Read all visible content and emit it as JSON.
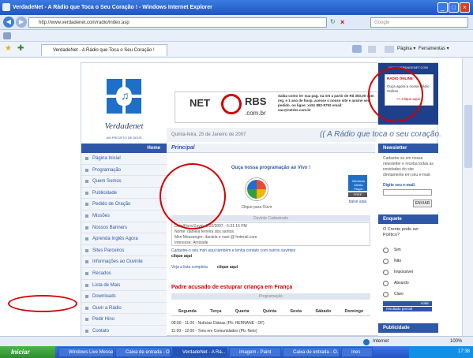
{
  "window": {
    "title": "VerdadeNet - A Rádio que Toca o Seu Coração ! - Windows Internet Explorer"
  },
  "browser": {
    "address": "http://www.verdadenet.com/radio/index.asp",
    "search_placeholder": "Google",
    "tab_label": "VerdadeNet - A Rádio que Toca o Seu Coração !",
    "toolbar": {
      "page": "Página",
      "tools": "Ferramentas"
    }
  },
  "site": {
    "logo_name": "Verdadenet",
    "logo_tagline": "UM PROJETO DE DEUS",
    "banner": {
      "net": "NET",
      "rbs": "RBS",
      "domain": ".com.br",
      "text": "Saiba como ter sua pag. na net a partir de R$ 350,00 com reg. e 1 ano de hosp. acesse o nosso site e assine seu pedido. ou ligue: xx51 882-8752  email: sac@netrbs.com.br"
    },
    "top_right": {
      "url": "WWW.VERDADENET.COM",
      "title": "RÁDIO ONLINE",
      "text": "Ouça agora a nossa Rádio Online!",
      "link": ">> Clique aqui!"
    },
    "date": "Quinta-feira, 25 de Janeiro de 2007",
    "slogan": "(( A Rádio que toca o seu coração."
  },
  "nav": {
    "head": "Home",
    "items": [
      {
        "label": "Página Inicial"
      },
      {
        "label": "Programação"
      },
      {
        "label": "Quem Somos"
      },
      {
        "label": "Publicidade"
      },
      {
        "label": "Pedido de Oração"
      },
      {
        "label": "Missões"
      },
      {
        "label": "Nossos Banners"
      },
      {
        "label": "Aprenda Inglês Agora"
      },
      {
        "label": "Sites Parceiros"
      },
      {
        "label": "Informações ao Ouvinte"
      },
      {
        "label": "Recados"
      },
      {
        "label": "Lista de Mais"
      },
      {
        "label": "Downloads"
      },
      {
        "label": "Ouvir a Rádio"
      },
      {
        "label": "Pedir Hino"
      },
      {
        "label": "Contato"
      }
    ]
  },
  "main": {
    "head": "Principal",
    "live": "Ouça nossa programação ao Vivo !",
    "listen": "Clique para Ouvir",
    "wmp": "Windows Media Player",
    "free": "FREE",
    "get": "baixe aqui",
    "listener_head": "Ouvinte Cadastrado",
    "listener": [
      "Data/Hora Envio: 1/25/2007 - 5:31:16 PM",
      "Nome: daniela ferreira dos santos",
      "Msn Messenger: daniela e nani @ hotmail.com",
      "Interesse: Amizade"
    ],
    "register": "Cadastre-o seu msn aqui também e tenha contato com outros ouvintes",
    "register_link": "clique aqui",
    "full_list": "Veja a lista completa",
    "full_list_link": "clique aqui",
    "headline": "Padre acusado de estuprar criança em França",
    "schedule_head": "Programação",
    "days": [
      "Segunda",
      "Terça",
      "Quarta",
      "Quinta",
      "Sexta",
      "Sábado",
      "Domingo"
    ],
    "rows": [
      "08:00 - 11:00 - Notícias Diárias (Pb. HERNANE - DF)",
      "11:00 - 12:00 - Tons em Comunidades (Pb. Nelo)"
    ]
  },
  "right": {
    "newsletter_head": "Newsletter",
    "newsletter_text": "Cadastre-se em nossa newsletter e receba todas as novidades do site diretamente em seu e-mail.",
    "email_label": "Digite seu e-mail:",
    "send": "ENVIAR",
    "poll_head": "Enquete",
    "poll_q": "O Crente pode ser Político?",
    "poll_opts": [
      "Sim",
      "Não",
      "Impossível",
      "Absurdo",
      "Claro"
    ],
    "vote": "votar",
    "results": "resultado parcial",
    "ads_head": "Publicidade"
  },
  "status": {
    "zone": "Internet",
    "zoom": "100%"
  },
  "taskbar": {
    "start": "Iniciar",
    "tasks": [
      "Windows Live Messenger",
      "Caixa de entrada - O...",
      "VerdadeNet - A Rá...",
      "imagem - Paint",
      "Caixa de entrada - O...",
      "Ines"
    ],
    "time": "17:38"
  }
}
